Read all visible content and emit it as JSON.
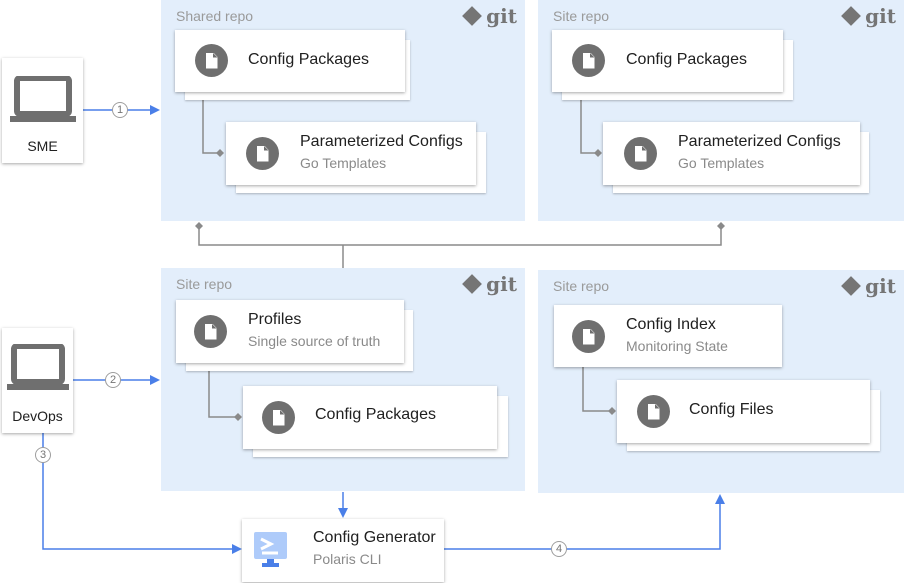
{
  "colors": {
    "panel": "#e3eefb",
    "arrow": "#4a7fe8",
    "connector": "#8a8a8a",
    "icon": "#6f6f6f"
  },
  "actors": {
    "sme": {
      "label": "SME",
      "icon": "laptop-icon"
    },
    "devops": {
      "label": "DevOps",
      "icon": "laptop-icon"
    }
  },
  "panels": {
    "shared_repo": {
      "label": "Shared repo",
      "logo": "git",
      "cards": [
        {
          "title": "Config Packages"
        },
        {
          "title": "Parameterized Configs",
          "subtitle": "Go Templates"
        }
      ]
    },
    "site_repo_top": {
      "label": "Site repo",
      "logo": "git",
      "cards": [
        {
          "title": "Config Packages"
        },
        {
          "title": "Parameterized Configs",
          "subtitle": "Go Templates"
        }
      ]
    },
    "site_repo_bottom": {
      "label": "Site repo",
      "logo": "git",
      "cards": [
        {
          "title": "Profiles",
          "subtitle": "Single source of truth"
        },
        {
          "title": "Config Packages"
        }
      ]
    },
    "site_repo_index": {
      "label": "Site repo",
      "logo": "git",
      "cards": [
        {
          "title": "Config Index",
          "subtitle": "Monitoring State"
        },
        {
          "title": "Config Files"
        }
      ]
    }
  },
  "generator": {
    "title": "Config Generator",
    "subtitle": "Polaris CLI",
    "icon": "terminal-icon"
  },
  "steps": [
    "1",
    "2",
    "3",
    "4"
  ]
}
